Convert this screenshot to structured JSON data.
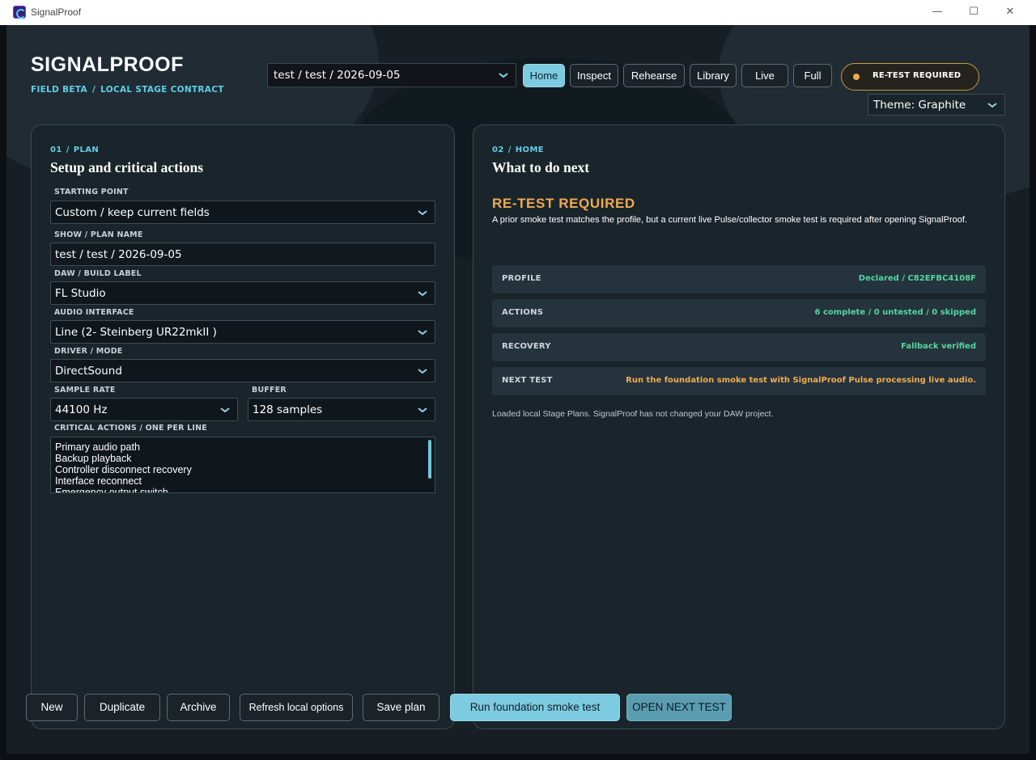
{
  "window": {
    "title": "SignalProof",
    "minimize": "—",
    "maximize": "☐",
    "close": "✕"
  },
  "brand": {
    "title": "SIGNALPROOF",
    "sub_a": "FIELD BETA",
    "sep": "/",
    "sub_b": "LOCAL STAGE CONTRACT"
  },
  "plan_select": {
    "value": "test / test / 2026-09-05"
  },
  "nav": [
    {
      "label": "Home",
      "active": true
    },
    {
      "label": "Inspect"
    },
    {
      "label": "Rehearse"
    },
    {
      "label": "Library"
    },
    {
      "label": "Live"
    },
    {
      "label": "Full"
    }
  ],
  "status_pill": {
    "label": "RE-TEST REQUIRED",
    "dot_color": "#f0a94a"
  },
  "theme_select": {
    "value": "Theme: Graphite"
  },
  "plan_panel": {
    "kicker_num": "01",
    "kicker_sep": "/",
    "kicker_label": "PLAN",
    "title": "Setup and critical actions",
    "fields": {
      "starting_point": {
        "label": "STARTING POINT",
        "value": "Custom / keep current fields"
      },
      "plan_name": {
        "label": "SHOW / PLAN NAME",
        "value": "test / test / 2026-09-05"
      },
      "daw": {
        "label": "DAW / BUILD LABEL",
        "value": "FL Studio"
      },
      "interface": {
        "label": "AUDIO INTERFACE",
        "value": "Line (2- Steinberg UR22mkII )"
      },
      "driver": {
        "label": "DRIVER / MODE",
        "value": "DirectSound"
      },
      "sample_rate": {
        "label": "SAMPLE RATE",
        "value": "44100 Hz"
      },
      "buffer": {
        "label": "BUFFER",
        "value": "128 samples"
      },
      "critical_actions": {
        "label": "CRITICAL ACTIONS  /  ONE PER LINE",
        "lines": [
          "Primary audio path",
          "Backup playback",
          "Controller disconnect recovery",
          "Interface reconnect",
          "Emergency output switch"
        ]
      }
    }
  },
  "home_panel": {
    "kicker_num": "02",
    "kicker_sep": "/",
    "kicker_label": "HOME",
    "title": "What to do next",
    "status_heading": "RE-TEST REQUIRED",
    "status_desc": "A prior smoke test matches the profile, but a current live Pulse/collector smoke test is required after opening SignalProof.",
    "rows": [
      {
        "key": "PROFILE",
        "value": "Declared / C82EFBC4108F",
        "tone": "ok"
      },
      {
        "key": "ACTIONS",
        "value": "6 complete / 0 untested / 0 skipped",
        "tone": "ok"
      },
      {
        "key": "RECOVERY",
        "value": "Fallback verified",
        "tone": "ok"
      },
      {
        "key": "NEXT TEST",
        "value": "Run the foundation smoke test with SignalProof Pulse processing live audio.",
        "tone": "warn"
      }
    ],
    "note": "Loaded local Stage Plans. SignalProof has not changed your DAW project."
  },
  "actions": {
    "new": "New",
    "duplicate": "Duplicate",
    "archive": "Archive",
    "refresh": "Refresh local options",
    "save": "Save plan",
    "run": "Run foundation smoke test",
    "open_next": "OPEN NEXT TEST"
  },
  "colors": {
    "accent": "#7dcbe0",
    "warning": "#f0aa50",
    "ok": "#55d6a0",
    "kicker": "#5fd0e6"
  }
}
